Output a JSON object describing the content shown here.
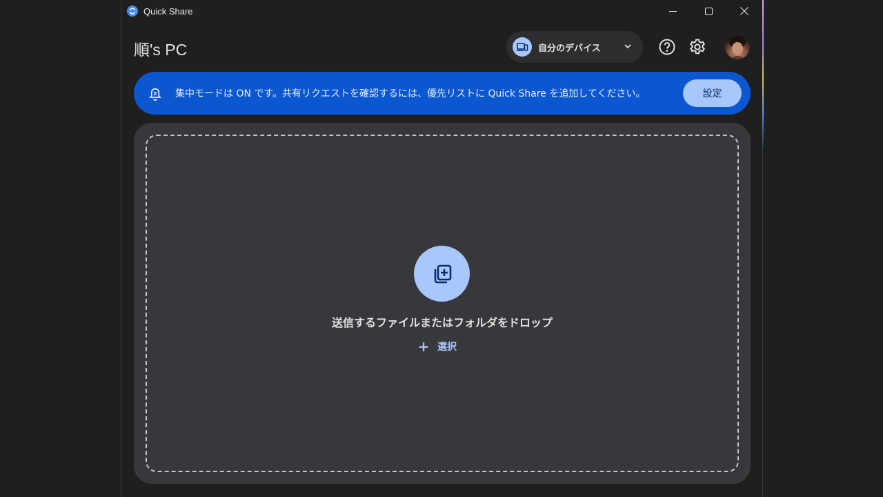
{
  "window": {
    "title": "Quick Share"
  },
  "header": {
    "pc_name": "順's PC",
    "visibility_selector": "自分のデバイス"
  },
  "banner": {
    "message": "集中モードは ON です。共有リクエストを確認するには、優先リストに Quick Share を追加してください。",
    "button_label": "設定"
  },
  "drop_zone": {
    "prompt": "送信するファイルまたはフォルダをドロップ",
    "select_label": "選択"
  },
  "colors": {
    "banner_bg": "#0b57d0",
    "accent_light": "#a8c7fa",
    "card_bg": "#37383b",
    "window_bg": "#1f1f1f"
  },
  "icons": {
    "app": "quick-share-icon",
    "minimize": "minimize-icon",
    "maximize": "maximize-icon",
    "close": "close-icon",
    "devices": "devices-icon",
    "chevron": "chevron-down-icon",
    "help": "help-icon",
    "settings": "gear-icon",
    "focus": "focus-bell-icon",
    "add_file": "add-file-icon",
    "plus": "plus-icon"
  }
}
